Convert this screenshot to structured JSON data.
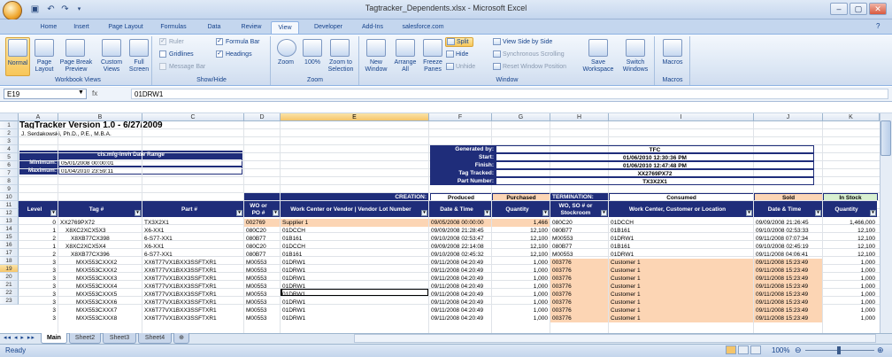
{
  "window": {
    "title": "Tagtracker_Dependents.xlsx - Microsoft Excel"
  },
  "tabs": [
    "Home",
    "Insert",
    "Page Layout",
    "Formulas",
    "Data",
    "Review",
    "View",
    "Developer",
    "Add-Ins",
    "salesforce.com"
  ],
  "active_tab": "View",
  "ribbon": {
    "groups": {
      "workbook_views": "Workbook Views",
      "show_hide": "Show/Hide",
      "zoom": "Zoom",
      "window": "Window",
      "macros": "Macros"
    },
    "workbook_views": {
      "normal": "Normal",
      "page_layout": "Page Layout",
      "page_break_preview": "Page Break Preview",
      "custom_views": "Custom Views",
      "full_screen": "Full Screen"
    },
    "show_hide": {
      "ruler": "Ruler",
      "gridlines": "Gridlines",
      "message_bar": "Message Bar",
      "formula_bar": "Formula Bar",
      "headings": "Headings"
    },
    "zoom": {
      "zoom": "Zoom",
      "hundred": "100%",
      "zoom_to_selection": "Zoom to Selection"
    },
    "window": {
      "new_window": "New Window",
      "arrange_all": "Arrange All",
      "freeze_panes": "Freeze Panes",
      "split": "Split",
      "hide": "Hide",
      "unhide": "Unhide",
      "side_by_side": "View Side by Side",
      "sync_scroll": "Synchronous Scrolling",
      "reset_position": "Reset Window Position",
      "save_workspace": "Save Workspace",
      "switch_windows": "Switch Windows"
    },
    "macros": {
      "macros": "Macros"
    }
  },
  "formula_bar": {
    "name_box": "E19",
    "fx": "fx",
    "value": "01DRW1"
  },
  "columns": [
    "A",
    "B",
    "C",
    "D",
    "E",
    "F",
    "G",
    "H",
    "I",
    "J",
    "K"
  ],
  "selected_column": "E",
  "selected_row": 19,
  "rows": [
    1,
    2,
    3,
    4,
    5,
    6,
    7,
    8,
    9,
    10,
    11,
    12,
    13,
    14,
    15,
    16,
    17,
    18,
    19,
    20,
    21,
    22,
    23
  ],
  "sheet": {
    "title": "TagTracker Version 1.0 - 6/27/2009",
    "author": "J. Serdakowski, Ph.D., P.E., M.B.A.",
    "date_range_title": "cis.mfg-invh Date Range",
    "minimum_label": "Minimum:",
    "minimum_value": "05/01/2008 00:00:01",
    "maximum_label": "Maximum:",
    "maximum_value": "01/04/2010 23:59:11",
    "info": [
      {
        "label": "Generated by:",
        "value": "TFC"
      },
      {
        "label": "Start:",
        "value": "01/06/2010 12:30:36 PM"
      },
      {
        "label": "Finish:",
        "value": "01/06/2010 12:47:48 PM"
      },
      {
        "label": "Tag Tracked:",
        "value": "XX2769PX72"
      },
      {
        "label": "Part Number:",
        "value": "TX3X2X1"
      }
    ],
    "creation_label": "CREATION:",
    "produced_label": "Produced",
    "purchased_label": "Purchased",
    "termination_label": "TERMINATION:",
    "consumed_label": "Consumed",
    "sold_label": "Sold",
    "instock_label": "In Stock",
    "headers": {
      "level": "Level",
      "tag": "Tag #",
      "part": "Part #",
      "wo_po": "WO or PO #",
      "work_center": "Work Center or Vendor | Vendor Lot Number",
      "date_time": "Date & Time",
      "quantity": "Quantity",
      "wo_so": "WO, SO # or Stockroom",
      "wc_customer": "Work Center, Customer or Location",
      "date_time2": "Date & Time",
      "quantity2": "Quantity"
    },
    "data": [
      {
        "level": "0",
        "tag": "XX2769PX72",
        "part": "TX3X2X1",
        "wo": "002769",
        "wc": "Supplier 1",
        "dt": "09/05/2008 00:00:00",
        "qty": "1,466",
        "wo2": "080C20",
        "wc2": "01DCCH",
        "dt2": "09/09/2008 21:26:45",
        "qty2": "1,466,000",
        "indent": 0,
        "style": "purchased"
      },
      {
        "level": "1",
        "tag": "X8XC2XCX5X3",
        "part": "X6-XX1",
        "wo": "080C20",
        "wc": "01DCCH",
        "dt": "09/09/2008 21:28:45",
        "qty": "12,100",
        "wo2": "080B77",
        "wc2": "01B161",
        "dt2": "09/10/2008 02:53:33",
        "qty2": "12,100",
        "indent": 1,
        "style": ""
      },
      {
        "level": "2",
        "tag": "X8XB77CX398",
        "part": "6-S77-XX1",
        "wo": "080B77",
        "wc": "01B161",
        "dt": "09/10/2008 02:53:47",
        "qty": "12,100",
        "wo2": "M00553",
        "wc2": "01DRW1",
        "dt2": "09/11/2008 07:07:34",
        "qty2": "12,100",
        "indent": 2,
        "style": ""
      },
      {
        "level": "1",
        "tag": "X8XC2XCX5X4",
        "part": "X6-XX1",
        "wo": "080C20",
        "wc": "01DCCH",
        "dt": "09/09/2008 22:14:08",
        "qty": "12,100",
        "wo2": "080B77",
        "wc2": "01B161",
        "dt2": "09/10/2008 02:45:19",
        "qty2": "12,100",
        "indent": 1,
        "style": ""
      },
      {
        "level": "2",
        "tag": "X8XB77CX396",
        "part": "6-S77-XX1",
        "wo": "080B77",
        "wc": "01B161",
        "dt": "09/10/2008 02:45:32",
        "qty": "12,100",
        "wo2": "M00553",
        "wc2": "01DRW1",
        "dt2": "09/11/2008 04:06:41",
        "qty2": "12,100",
        "indent": 2,
        "style": ""
      },
      {
        "level": "3",
        "tag": "MXX553CXXX2",
        "part": "XX6T77VX1BXX3SSFTXR1",
        "wo": "M00553",
        "wc": "01DRW1",
        "dt": "09/11/2008 04:20:49",
        "qty": "1,000",
        "wo2": "003776",
        "wc2": "Customer 1",
        "dt2": "09/11/2008 15:23:49",
        "qty2": "1,000",
        "indent": 3,
        "style": "sold"
      },
      {
        "level": "3",
        "tag": "MXX553CXXX2",
        "part": "XX6T77VX1BXX3SSFTXR1",
        "wo": "M00553",
        "wc": "01DRW1",
        "dt": "09/11/2008 04:20:49",
        "qty": "1,000",
        "wo2": "003776",
        "wc2": "Customer 1",
        "dt2": "09/11/2008 15:23:49",
        "qty2": "1,000",
        "indent": 3,
        "style": "sold"
      },
      {
        "level": "3",
        "tag": "MXX553CXXX3",
        "part": "XX6T77VX1BXX3SSFTXR1",
        "wo": "M00553",
        "wc": "01DRW1",
        "dt": "09/11/2008 04:20:49",
        "qty": "1,000",
        "wo2": "003776",
        "wc2": "Customer 1",
        "dt2": "09/11/2008 15:23:49",
        "qty2": "1,000",
        "indent": 3,
        "style": "sold"
      },
      {
        "level": "3",
        "tag": "MXX553CXXX4",
        "part": "XX6T77VX1BXX3SSFTXR1",
        "wo": "M00553",
        "wc": "01DRW1",
        "dt": "09/11/2008 04:20:49",
        "qty": "1,000",
        "wo2": "003776",
        "wc2": "Customer 1",
        "dt2": "09/11/2008 15:23:49",
        "qty2": "1,000",
        "indent": 3,
        "style": "sold"
      },
      {
        "level": "3",
        "tag": "MXX553CXXX5",
        "part": "XX6T77VX1BXX3SSFTXR1",
        "wo": "M00553",
        "wc": "01DRW1",
        "dt": "09/11/2008 04:20:49",
        "qty": "1,000",
        "wo2": "003776",
        "wc2": "Customer 1",
        "dt2": "09/11/2008 15:23:49",
        "qty2": "1,000",
        "indent": 3,
        "style": "sold"
      },
      {
        "level": "3",
        "tag": "MXX553CXXX6",
        "part": "XX6T77VX1BXX3SSFTXR1",
        "wo": "M00553",
        "wc": "01DRW1",
        "dt": "09/11/2008 04:20:49",
        "qty": "1,000",
        "wo2": "003776",
        "wc2": "Customer 1",
        "dt2": "09/11/2008 15:23:49",
        "qty2": "1,000",
        "indent": 3,
        "style": "sold"
      },
      {
        "level": "3",
        "tag": "MXX553CXXX7",
        "part": "XX6T77VX1BXX3SSFTXR1",
        "wo": "M00553",
        "wc": "01DRW1",
        "dt": "09/11/2008 04:20:49",
        "qty": "1,000",
        "wo2": "003776",
        "wc2": "Customer 1",
        "dt2": "09/11/2008 15:23:49",
        "qty2": "1,000",
        "indent": 3,
        "style": "sold"
      },
      {
        "level": "3",
        "tag": "MXX553CXXX8",
        "part": "XX6T77VX1BXX3SSFTXR1",
        "wo": "M00553",
        "wc": "01DRW1",
        "dt": "09/11/2008 04:20:49",
        "qty": "1,000",
        "wo2": "003776",
        "wc2": "Customer 1",
        "dt2": "09/11/2008 15:23:49",
        "qty2": "1,000",
        "indent": 3,
        "style": "sold"
      }
    ]
  },
  "sheet_tabs": [
    "Main",
    "Sheet2",
    "Sheet3",
    "Sheet4"
  ],
  "active_sheet": "Main",
  "status": {
    "ready": "Ready",
    "zoom": "100%"
  },
  "colors": {
    "navy": "#1f2d7a",
    "purchased": "#fcd5b4",
    "instock": "#d8f0d0",
    "selected_header": "#f5c56a"
  }
}
